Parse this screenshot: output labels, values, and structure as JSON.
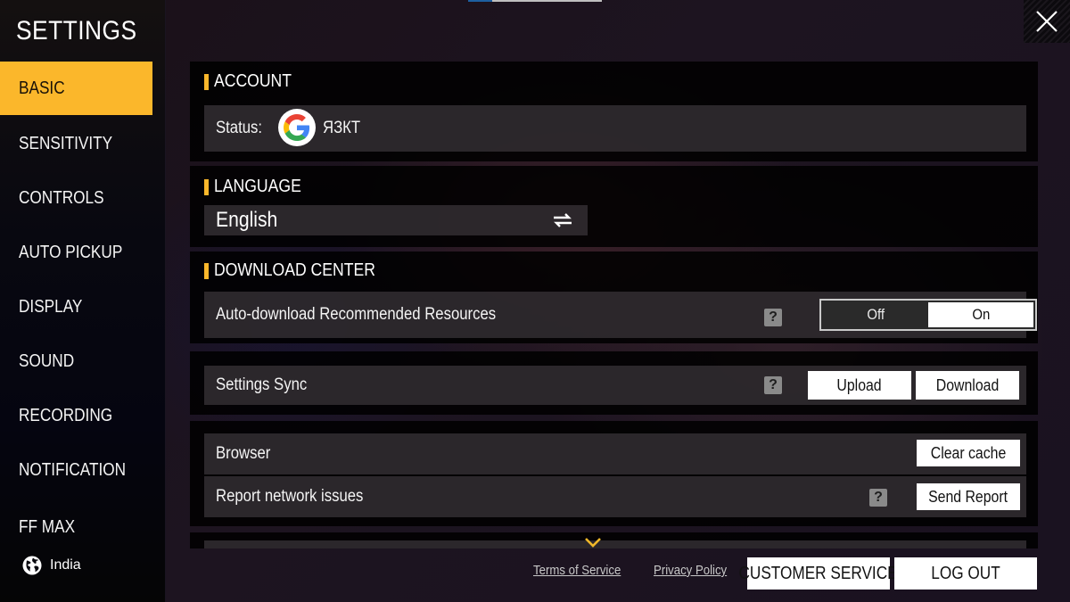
{
  "sidebar": {
    "title": "SETTINGS",
    "items": [
      {
        "label": "BASIC",
        "active": true
      },
      {
        "label": "SENSITIVITY",
        "active": false
      },
      {
        "label": "CONTROLS",
        "active": false
      },
      {
        "label": "AUTO PICKUP",
        "active": false
      },
      {
        "label": "DISPLAY",
        "active": false
      },
      {
        "label": "SOUND",
        "active": false
      },
      {
        "label": "RECORDING",
        "active": false
      },
      {
        "label": "NOTIFICATION",
        "active": false
      },
      {
        "label": "FF MAX",
        "active": false
      }
    ],
    "region": {
      "icon": "globe-icon",
      "label": "India"
    }
  },
  "close": {
    "icon": "close-icon"
  },
  "colors": {
    "accent": "#fbb72b",
    "panel_bg": "#000000",
    "row_bg": "#343034",
    "button_bg": "#ffffff",
    "help_icon": "#8a8a8a"
  },
  "account": {
    "header": "ACCOUNT",
    "status_label": "Status:",
    "provider_icon": "google-icon",
    "username": "ЯЗКТ"
  },
  "language": {
    "header": "LANGUAGE",
    "value": "English",
    "switch_icon": "swap-arrows-icon"
  },
  "download_center": {
    "header": "DOWNLOAD CENTER",
    "auto_download": {
      "label": "Auto-download Recommended Resources",
      "help_icon": "?",
      "options": [
        "Off",
        "On"
      ],
      "selected": "On"
    }
  },
  "settings_sync": {
    "label": "Settings Sync",
    "help_icon": "?",
    "upload_label": "Upload",
    "download_label": "Download"
  },
  "browser": {
    "label": "Browser",
    "clear_cache_label": "Clear cache"
  },
  "network": {
    "label": "Report network issues",
    "help_icon": "?",
    "send_report_label": "Send Report"
  },
  "footer": {
    "terms": "Terms of Service",
    "privacy": "Privacy Policy",
    "customer_service": "CUSTOMER SERVICE",
    "logout": "LOG OUT"
  }
}
